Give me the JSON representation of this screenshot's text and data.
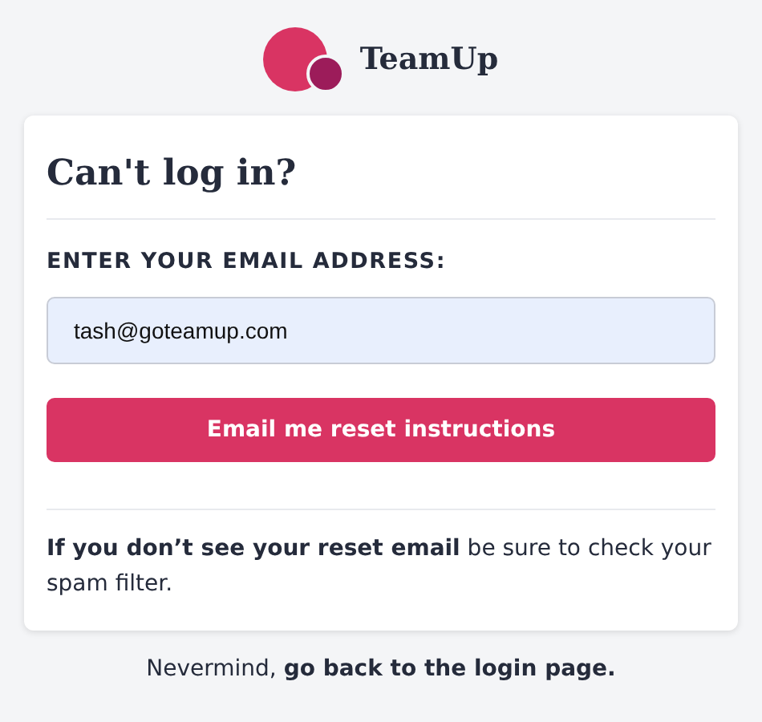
{
  "brand": {
    "name": "TeamUp"
  },
  "heading": "Can't log in?",
  "email_label": "ENTER YOUR EMAIL ADDRESS:",
  "email_field": {
    "value": "tash@goteamup.com"
  },
  "submit_button": "Email me reset instructions",
  "hint": "**If you don’t see your reset email** be sure to check your spam filter.",
  "footer": {
    "text": "Nevermind,",
    "link": "go back to the login page."
  }
}
